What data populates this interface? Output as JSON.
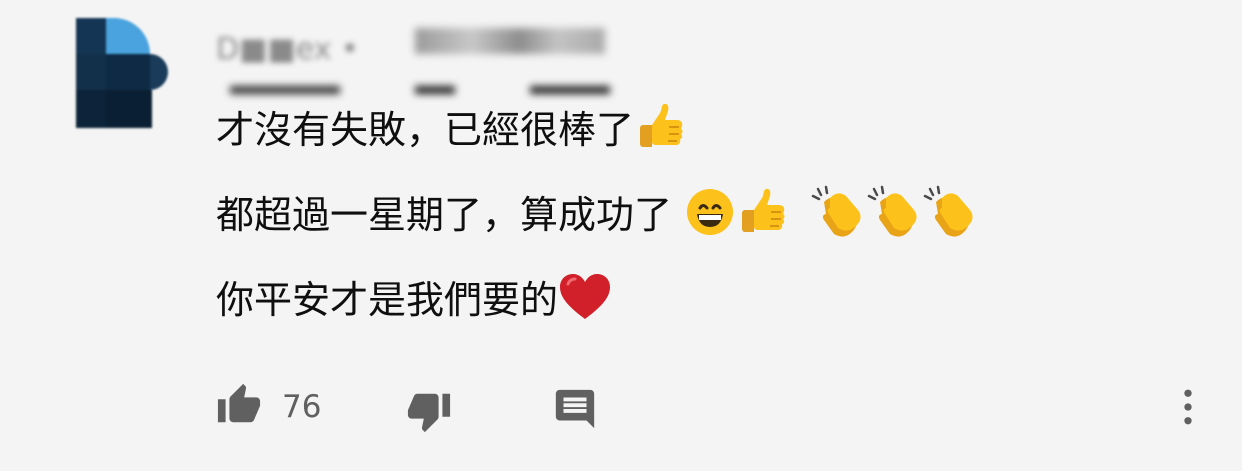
{
  "comment": {
    "author_name": "D■■ex •",
    "lines": [
      {
        "text": "才沒有失敗，已經很棒了",
        "emojis": [
          "thumbs-up"
        ]
      },
      {
        "text": "都超過一星期了，算成功了",
        "emojis": [
          "grinning-face",
          "thumbs-up",
          "clapping-hands",
          "clapping-hands",
          "clapping-hands"
        ]
      },
      {
        "text": "你平安才是我們要的",
        "emojis": [
          "red-heart"
        ]
      }
    ],
    "like_count": "76"
  },
  "icons": {
    "like": "thumbs-up-icon",
    "dislike": "thumbs-down-icon",
    "reply": "comment-icon",
    "more": "more-vertical-icon"
  },
  "colors": {
    "background": "#f4f4f4",
    "text": "#0f0f0f",
    "icon": "#606060",
    "heart": "#d1202a",
    "emoji_yellow": "#fbc02d"
  }
}
